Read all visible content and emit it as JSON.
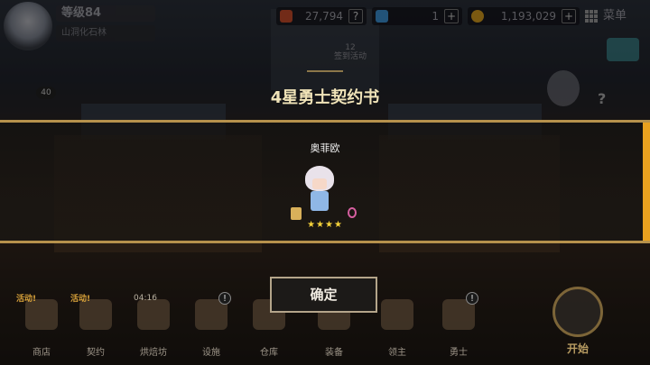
{
  "topbar": {
    "level": "等级84",
    "guild": "山洞化石林",
    "gems": "27,794",
    "diamonds": "1",
    "gold": "1,193,029",
    "menu": "菜单",
    "plus": "+",
    "question": "?"
  },
  "event": {
    "date": "12",
    "label": "签到活动"
  },
  "left_badge": "40",
  "dialog": {
    "title": "4星勇士契约书",
    "hero_name": "奥菲欧",
    "stars": "★★★★",
    "confirm": "确定"
  },
  "nav": [
    {
      "label": "商店",
      "tag": "活动!",
      "timer": "",
      "alert": ""
    },
    {
      "label": "契约",
      "tag": "活动!",
      "timer": "",
      "alert": ""
    },
    {
      "label": "烘焙坊",
      "tag": "",
      "timer": "04:16",
      "alert": ""
    },
    {
      "label": "设施",
      "tag": "",
      "timer": "",
      "alert": "!"
    },
    {
      "label": "仓库",
      "tag": "",
      "timer": "",
      "alert": ""
    },
    {
      "label": "装备",
      "tag": "",
      "timer": "",
      "alert": "!"
    },
    {
      "label": "领主",
      "tag": "",
      "timer": "",
      "alert": ""
    },
    {
      "label": "勇士",
      "tag": "",
      "timer": "",
      "alert": "!"
    }
  ],
  "start_label": "开始"
}
